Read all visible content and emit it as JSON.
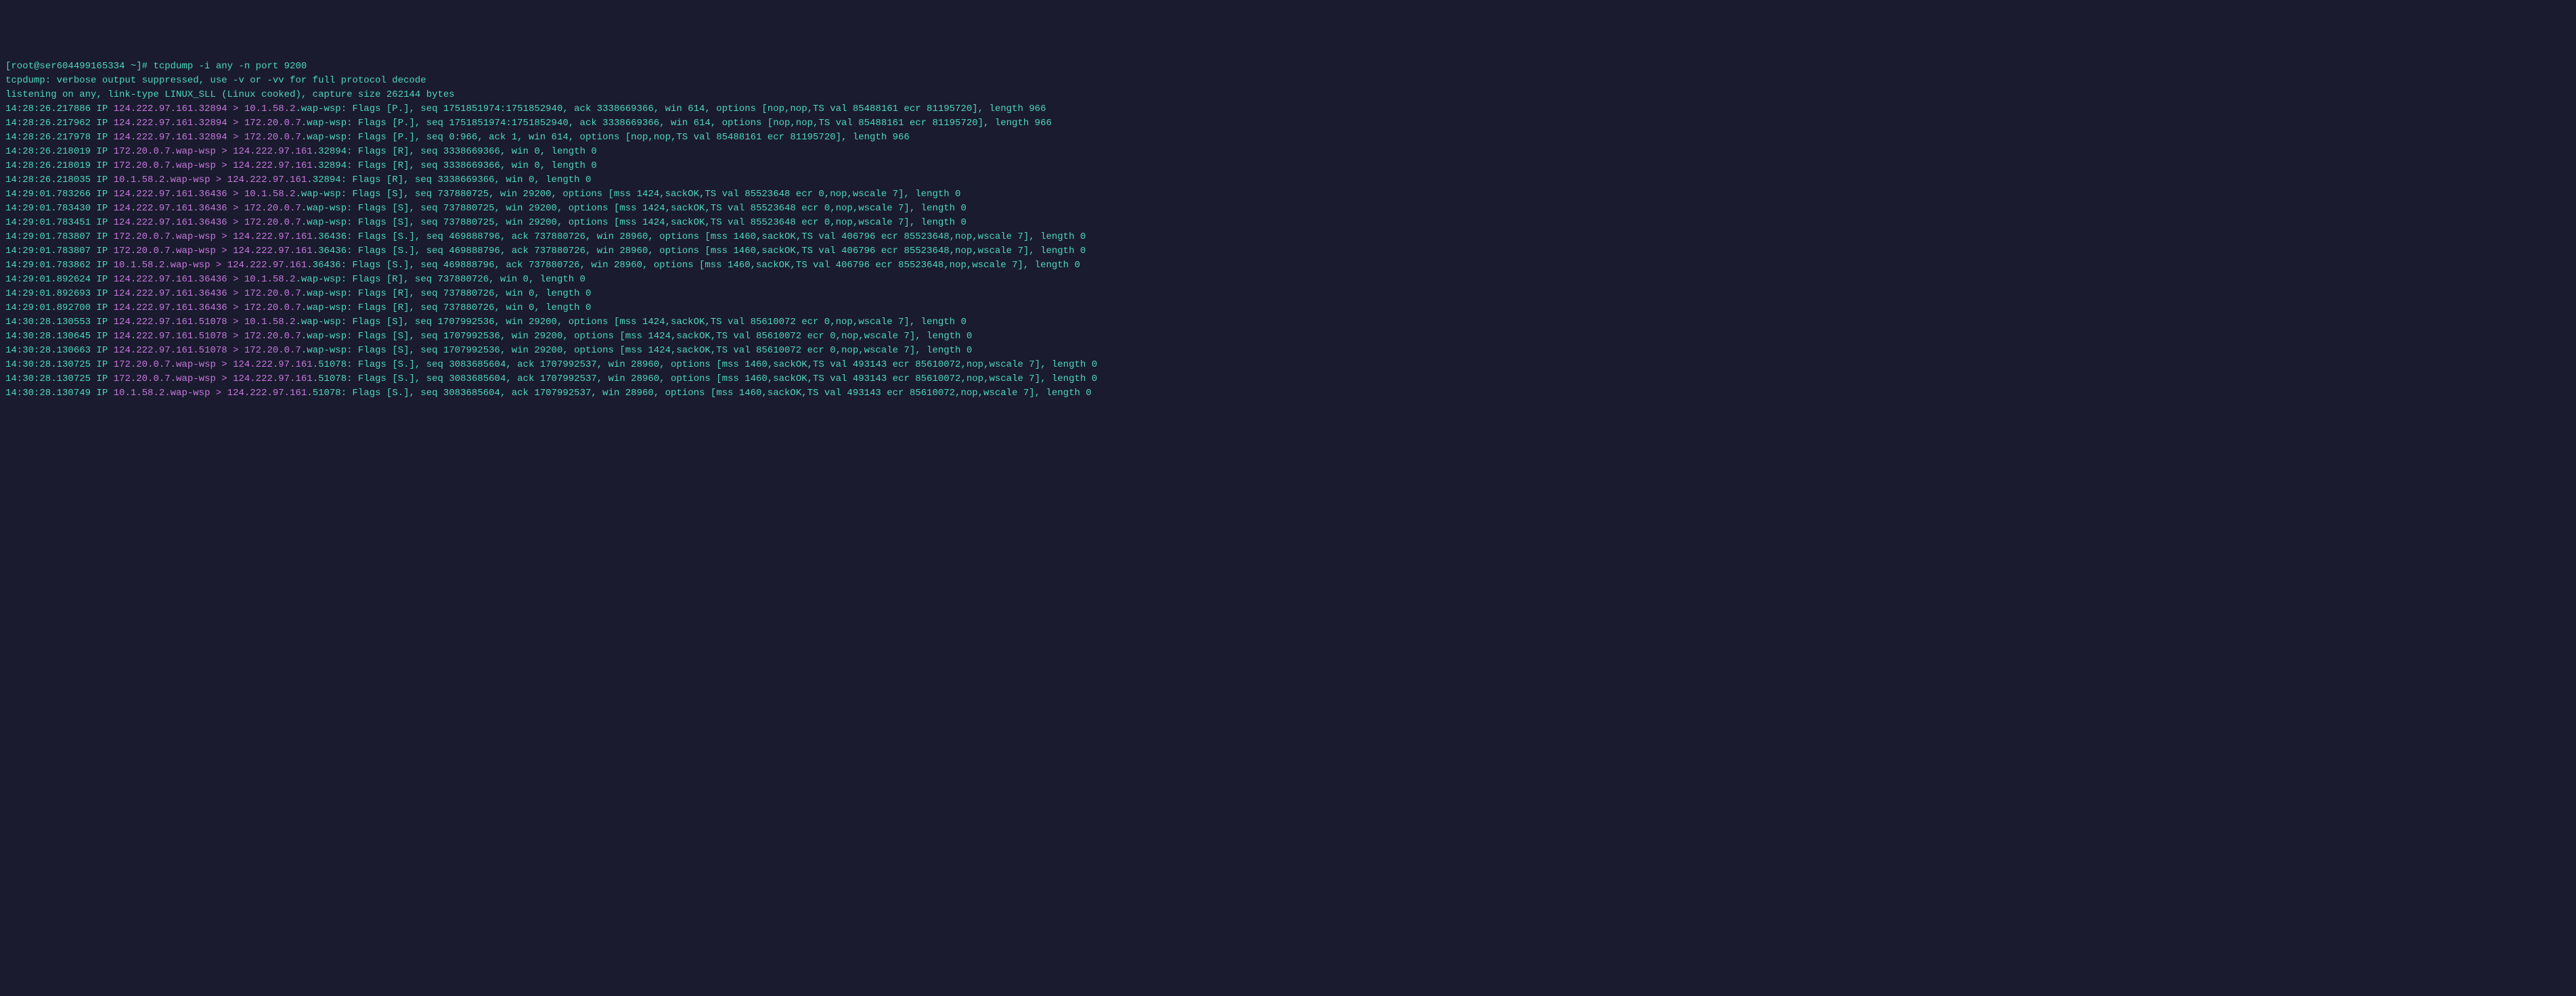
{
  "prompt": "[root@ser604499165334 ~]# ",
  "command": "tcpdump -i any -n port 9200",
  "info_lines": [
    "tcpdump: verbose output suppressed, use -v or -vv for full protocol decode",
    "listening on any, link-type LINUX_SLL (Linux cooked), capture size 262144 bytes"
  ],
  "packets": [
    {
      "ts": "14:28:26.217886 IP ",
      "addr": "124.222.97.161.32894 > 10.1.58.2",
      "rest": ".wap-wsp: Flags [P.], seq 1751851974:1751852940, ack 3338669366, win 614, options [nop,nop,TS val 85488161 ecr 81195720], length 966"
    },
    {
      "ts": "14:28:26.217962 IP ",
      "addr": "124.222.97.161.32894 > 172.20.0.7",
      "rest": ".wap-wsp: Flags [P.], seq 1751851974:1751852940, ack 3338669366, win 614, options [nop,nop,TS val 85488161 ecr 81195720], length 966"
    },
    {
      "ts": "14:28:26.217978 IP ",
      "addr": "124.222.97.161.32894 > 172.20.0.7",
      "rest": ".wap-wsp: Flags [P.], seq 0:966, ack 1, win 614, options [nop,nop,TS val 85488161 ecr 81195720], length 966"
    },
    {
      "ts": "14:28:26.218019 IP ",
      "addr": "172.20.0.7.wap-wsp > 124.222.97.161",
      "rest": ".32894: Flags [R], seq 3338669366, win 0, length 0"
    },
    {
      "ts": "14:28:26.218019 IP ",
      "addr": "172.20.0.7.wap-wsp > 124.222.97.161",
      "rest": ".32894: Flags [R], seq 3338669366, win 0, length 0"
    },
    {
      "ts": "14:28:26.218035 IP ",
      "addr": "10.1.58.2.wap-wsp > 124.222.97.161",
      "rest": ".32894: Flags [R], seq 3338669366, win 0, length 0"
    },
    {
      "ts": "14:29:01.783266 IP ",
      "addr": "124.222.97.161.36436 > 10.1.58.2",
      "rest": ".wap-wsp: Flags [S], seq 737880725, win 29200, options [mss 1424,sackOK,TS val 85523648 ecr 0,nop,wscale 7], length 0"
    },
    {
      "ts": "14:29:01.783430 IP ",
      "addr": "124.222.97.161.36436 > 172.20.0.7",
      "rest": ".wap-wsp: Flags [S], seq 737880725, win 29200, options [mss 1424,sackOK,TS val 85523648 ecr 0,nop,wscale 7], length 0"
    },
    {
      "ts": "14:29:01.783451 IP ",
      "addr": "124.222.97.161.36436 > 172.20.0.7",
      "rest": ".wap-wsp: Flags [S], seq 737880725, win 29200, options [mss 1424,sackOK,TS val 85523648 ecr 0,nop,wscale 7], length 0"
    },
    {
      "ts": "14:29:01.783807 IP ",
      "addr": "172.20.0.7.wap-wsp > 124.222.97.161",
      "rest": ".36436: Flags [S.], seq 469888796, ack 737880726, win 28960, options [mss 1460,sackOK,TS val 406796 ecr 85523648,nop,wscale 7], length 0"
    },
    {
      "ts": "14:29:01.783807 IP ",
      "addr": "172.20.0.7.wap-wsp > 124.222.97.161",
      "rest": ".36436: Flags [S.], seq 469888796, ack 737880726, win 28960, options [mss 1460,sackOK,TS val 406796 ecr 85523648,nop,wscale 7], length 0"
    },
    {
      "ts": "14:29:01.783862 IP ",
      "addr": "10.1.58.2.wap-wsp > 124.222.97.161",
      "rest": ".36436: Flags [S.], seq 469888796, ack 737880726, win 28960, options [mss 1460,sackOK,TS val 406796 ecr 85523648,nop,wscale 7], length 0"
    },
    {
      "ts": "14:29:01.892624 IP ",
      "addr": "124.222.97.161.36436 > 10.1.58.2",
      "rest": ".wap-wsp: Flags [R], seq 737880726, win 0, length 0"
    },
    {
      "ts": "14:29:01.892693 IP ",
      "addr": "124.222.97.161.36436 > 172.20.0.7",
      "rest": ".wap-wsp: Flags [R], seq 737880726, win 0, length 0"
    },
    {
      "ts": "14:29:01.892700 IP ",
      "addr": "124.222.97.161.36436 > 172.20.0.7",
      "rest": ".wap-wsp: Flags [R], seq 737880726, win 0, length 0"
    },
    {
      "ts": "14:30:28.130553 IP ",
      "addr": "124.222.97.161.51078 > 10.1.58.2",
      "rest": ".wap-wsp: Flags [S], seq 1707992536, win 29200, options [mss 1424,sackOK,TS val 85610072 ecr 0,nop,wscale 7], length 0"
    },
    {
      "ts": "14:30:28.130645 IP ",
      "addr": "124.222.97.161.51078 > 172.20.0.7",
      "rest": ".wap-wsp: Flags [S], seq 1707992536, win 29200, options [mss 1424,sackOK,TS val 85610072 ecr 0,nop,wscale 7], length 0"
    },
    {
      "ts": "14:30:28.130663 IP ",
      "addr": "124.222.97.161.51078 > 172.20.0.7",
      "rest": ".wap-wsp: Flags [S], seq 1707992536, win 29200, options [mss 1424,sackOK,TS val 85610072 ecr 0,nop,wscale 7], length 0"
    },
    {
      "ts": "14:30:28.130725 IP ",
      "addr": "172.20.0.7.wap-wsp > 124.222.97.161",
      "rest": ".51078: Flags [S.], seq 3083685604, ack 1707992537, win 28960, options [mss 1460,sackOK,TS val 493143 ecr 85610072,nop,wscale 7], length 0"
    },
    {
      "ts": "14:30:28.130725 IP ",
      "addr": "172.20.0.7.wap-wsp > 124.222.97.161",
      "rest": ".51078: Flags [S.], seq 3083685604, ack 1707992537, win 28960, options [mss 1460,sackOK,TS val 493143 ecr 85610072,nop,wscale 7], length 0"
    },
    {
      "ts": "14:30:28.130749 IP ",
      "addr": "10.1.58.2.wap-wsp > 124.222.97.161",
      "rest": ".51078: Flags [S.], seq 3083685604, ack 1707992537, win 28960, options [mss 1460,sackOK,TS val 493143 ecr 85610072,nop,wscale 7], length 0"
    }
  ]
}
